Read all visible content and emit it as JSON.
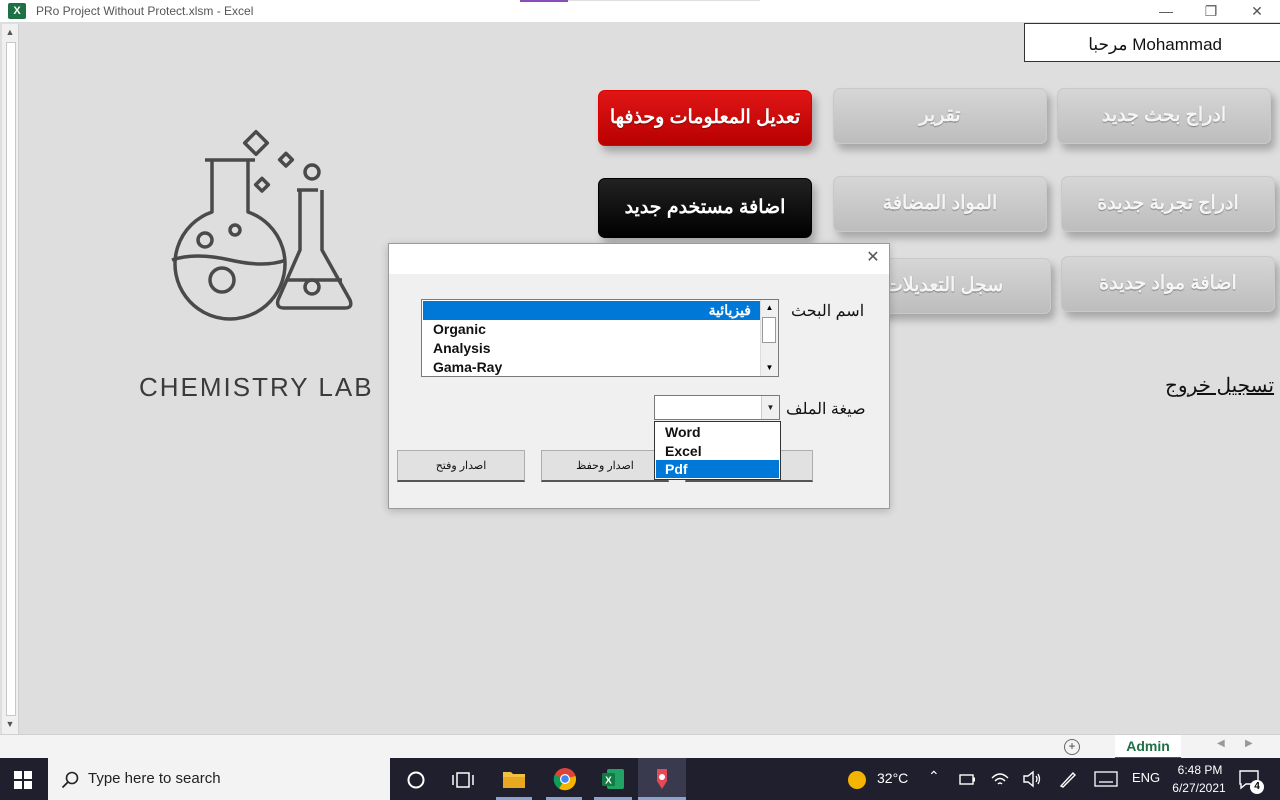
{
  "window": {
    "title": "PRo Project Without Protect.xlsm - Excel",
    "app_icon": "X",
    "controls": {
      "minimize": "—",
      "restore": "❐",
      "close": "✕"
    }
  },
  "welcome": {
    "text": "مرحبا  Mohammad"
  },
  "buttons": {
    "new_research": "ادراج بحث جديد",
    "report": "تقرير",
    "edit_delete": "تعديل المعلومات وحذفها",
    "new_experiment": "ادراج تجربة جديدة",
    "added_materials": "المواد المضافة",
    "add_user": "اضافة مستخدم جديد",
    "new_materials": "اضافة مواد جديدة",
    "changes_log": "سجل التعديلات"
  },
  "logout": "تسجيل خروج",
  "lab_label": "CHEMISTRY LAB",
  "dialog": {
    "close": "✕",
    "research_label": "اسم البحث",
    "research_items": [
      "فيزيائية",
      "Organic",
      "Analysis",
      "Gama-Ray"
    ],
    "selected_research": "فيزيائية",
    "format_label": "صيغة الملف",
    "format_value": "",
    "format_options": [
      "Word",
      "Excel",
      "Pdf"
    ],
    "selected_format": "Pdf",
    "btn_export_open": "اصدار وفتح",
    "btn_export_save": "اصدار وحفظ"
  },
  "sheet_tabs": {
    "active": "Admin",
    "add": "+"
  },
  "taskbar": {
    "search_placeholder": "Type here to search",
    "weather": "32°C",
    "language": "ENG",
    "time": "6:48 PM",
    "date": "6/27/2021",
    "notifications": "4"
  },
  "colors": {
    "accent_red": "#d00000",
    "accent_black": "#000000",
    "excel_green": "#1e7145",
    "selection_blue": "#0078d7"
  }
}
